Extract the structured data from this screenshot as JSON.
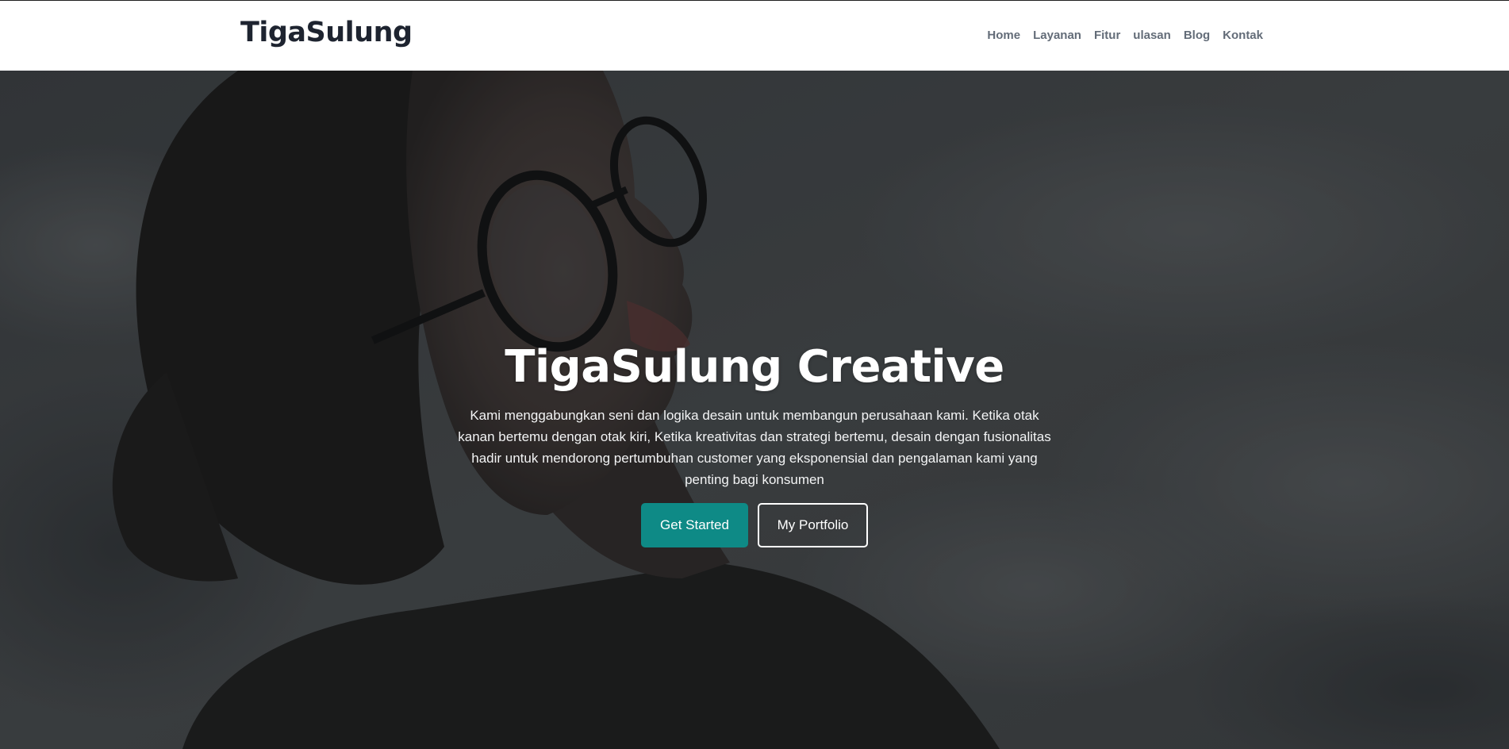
{
  "header": {
    "brand": "TigaSulung",
    "nav": [
      {
        "label": "Home"
      },
      {
        "label": "Layanan"
      },
      {
        "label": "Fitur"
      },
      {
        "label": "ulasan"
      },
      {
        "label": "Blog"
      },
      {
        "label": "Kontak"
      }
    ]
  },
  "hero": {
    "title": "TigaSulung Creative",
    "description": "Kami menggabungkan seni dan logika desain untuk membangun perusahaan kami. Ketika otak kanan bertemu dengan otak kiri, Ketika kreativitas dan strategi bertemu, desain dengan fusionalitas hadir untuk mendorong pertumbuhan customer yang eksponensial dan pengalaman kami yang penting bagi konsumen",
    "primary_button": "Get Started",
    "secondary_button": "My Portfolio"
  },
  "colors": {
    "accent": "#0e8a86",
    "brand_text": "#1e2430",
    "nav_text": "#636c78"
  }
}
